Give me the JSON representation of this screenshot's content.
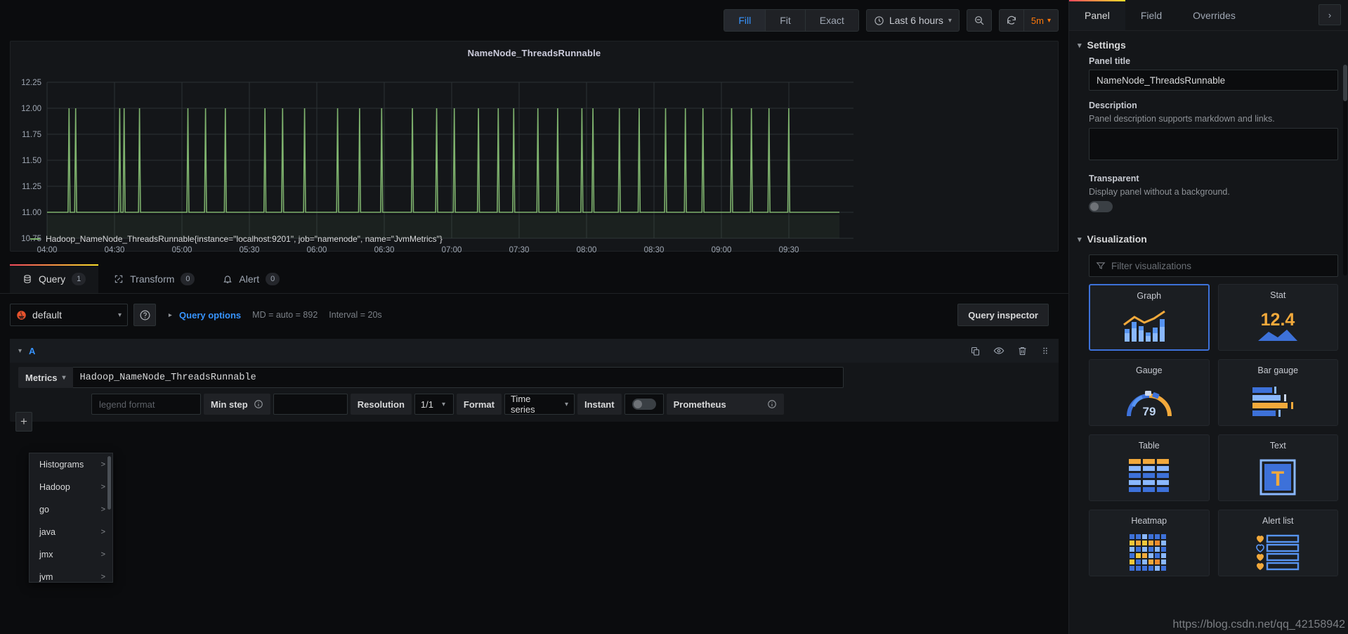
{
  "toolbar": {
    "fit_modes": [
      {
        "label": "Fill",
        "active": true
      },
      {
        "label": "Fit",
        "active": false
      },
      {
        "label": "Exact",
        "active": false
      }
    ],
    "time_range": "Last 6 hours",
    "zoom_out_icon": "zoom-out-icon",
    "refresh_icon": "refresh-icon",
    "refresh_interval": "5m"
  },
  "panel": {
    "title": "NameNode_ThreadsRunnable",
    "legend": "Hadoop_NameNode_ThreadsRunnable{instance=\"localhost:9201\", job=\"namenode\", name=\"JvmMetrics\"}",
    "legend_color": "#7eb26d"
  },
  "chart_data": {
    "type": "line",
    "title": "NameNode_ThreadsRunnable",
    "xlabel": "",
    "ylabel": "",
    "ylim": [
      10.75,
      12.25
    ],
    "ytick_labels": [
      "12.25",
      "12.00",
      "11.75",
      "11.50",
      "11.25",
      "11.00",
      "10.75"
    ],
    "ytick_values": [
      12.25,
      12.0,
      11.75,
      11.5,
      11.25,
      11.0,
      10.75
    ],
    "xtick_labels": [
      "04:00",
      "04:30",
      "05:00",
      "05:30",
      "06:00",
      "06:30",
      "07:00",
      "07:30",
      "08:00",
      "08:30",
      "09:00",
      "09:30"
    ],
    "grid": true,
    "legend_position": "bottom-left",
    "series": [
      {
        "name": "Hadoop_NameNode_ThreadsRunnable{instance=\"localhost:9201\", job=\"namenode\", name=\"JvmMetrics\"}",
        "color": "#7eb26d",
        "baseline": 11.0,
        "spike_value": 12.0,
        "spike_times_minutes": [
          10,
          13,
          33,
          35,
          42,
          64,
          72,
          81,
          99,
          107,
          117,
          132,
          142,
          152,
          166,
          177,
          185,
          196,
          205,
          212,
          223,
          232,
          243,
          248,
          260,
          269,
          281,
          290,
          298,
          311,
          320,
          328,
          337
        ]
      }
    ]
  },
  "query_tabs": [
    {
      "label": "Query",
      "count": "1",
      "active": true,
      "icon": "database-icon"
    },
    {
      "label": "Transform",
      "count": "0",
      "active": false,
      "icon": "transform-icon"
    },
    {
      "label": "Alert",
      "count": "0",
      "active": false,
      "icon": "bell-icon"
    }
  ],
  "datasource": {
    "name": "default",
    "icon": "prometheus-icon",
    "help_icon": "help-circle-icon"
  },
  "query_options": {
    "expand_icon": "chevron-right-icon",
    "label": "Query options",
    "max_data_points": "MD = auto = 892",
    "interval": "Interval = 20s"
  },
  "query_inspector": {
    "label": "Query inspector"
  },
  "query_a": {
    "ref_id": "A",
    "collapse_icon": "chevron-down-icon",
    "actions": [
      "copy-icon",
      "eye-icon",
      "trash-icon",
      "drag-handle-icon"
    ],
    "metrics_label": "Metrics",
    "expr": "Hadoop_NameNode_ThreadsRunnable",
    "legend_placeholder": "legend format",
    "min_step_label": "Min step",
    "min_step_value": "",
    "resolution_label": "Resolution",
    "resolution_value": "1/1",
    "format_label": "Format",
    "format_value": "Time series",
    "instant_label": "Instant",
    "instant_on": false,
    "datasource_label": "Prometheus",
    "add_query_label": "+"
  },
  "metrics_menu": {
    "items": [
      {
        "label": "Histograms",
        "arrow": ">"
      },
      {
        "label": "Hadoop",
        "arrow": ">"
      },
      {
        "label": "go",
        "arrow": ">"
      },
      {
        "label": "java",
        "arrow": ">"
      },
      {
        "label": "jmx",
        "arrow": ">"
      },
      {
        "label": "jvm",
        "arrow": ">"
      }
    ]
  },
  "options_pane": {
    "tabs": [
      {
        "label": "Panel",
        "active": true
      },
      {
        "label": "Field",
        "active": false
      },
      {
        "label": "Overrides",
        "active": false
      }
    ],
    "collapse_icon": "chevron-right-icon",
    "settings": {
      "section_title": "Settings",
      "panel_title_label": "Panel title",
      "panel_title_value": "NameNode_ThreadsRunnable",
      "description_label": "Description",
      "description_help": "Panel description supports markdown and links.",
      "description_value": "",
      "transparent_label": "Transparent",
      "transparent_help": "Display panel without a background.",
      "transparent_on": false
    },
    "visualization": {
      "section_title": "Visualization",
      "filter_placeholder": "Filter visualizations",
      "filter_icon": "filter-icon",
      "items": [
        {
          "label": "Graph",
          "selected": true,
          "art": "graph"
        },
        {
          "label": "Stat",
          "selected": false,
          "art": "stat",
          "value": "12.4"
        },
        {
          "label": "Gauge",
          "selected": false,
          "art": "gauge",
          "value": "79"
        },
        {
          "label": "Bar gauge",
          "selected": false,
          "art": "bargauge"
        },
        {
          "label": "Table",
          "selected": false,
          "art": "table"
        },
        {
          "label": "Text",
          "selected": false,
          "art": "text",
          "value": "T"
        },
        {
          "label": "Heatmap",
          "selected": false,
          "art": "heatmap"
        },
        {
          "label": "Alert list",
          "selected": false,
          "art": "alertlist"
        }
      ]
    }
  },
  "watermark": "https://blog.csdn.net/qq_42158942",
  "colors": {
    "accent_blue": "#3794ff",
    "accent_orange": "#ff780a",
    "series_green": "#7eb26d",
    "selection_blue": "#3d71d9"
  }
}
